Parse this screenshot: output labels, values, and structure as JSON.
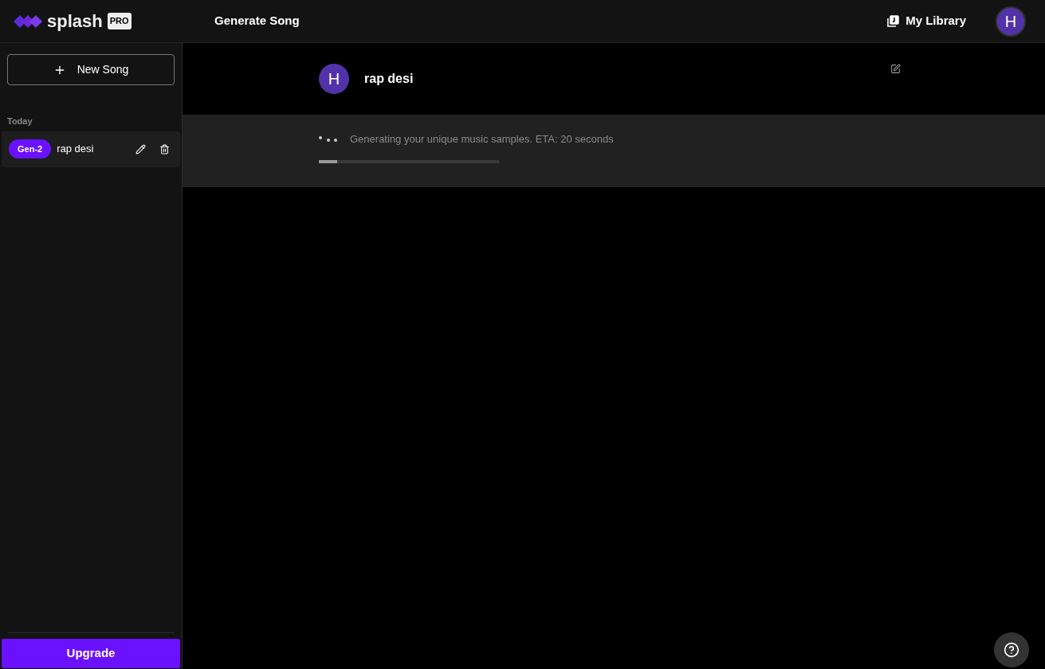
{
  "header": {
    "brand": "splash",
    "brand_badge": "PRO",
    "title": "Generate Song",
    "library_link": "My Library",
    "avatar_initial": "H"
  },
  "sidebar": {
    "new_button": "New Song",
    "section": "Today",
    "items": [
      {
        "tag": "Gen-2",
        "title": "rap desi",
        "selected": true
      }
    ],
    "upgrade_button": "Upgrade"
  },
  "song": {
    "avatar_initial": "H",
    "title": "rap desi"
  },
  "progress": {
    "message": "Generating your unique music samples. ETA: 20 seconds",
    "level": 0.1
  }
}
